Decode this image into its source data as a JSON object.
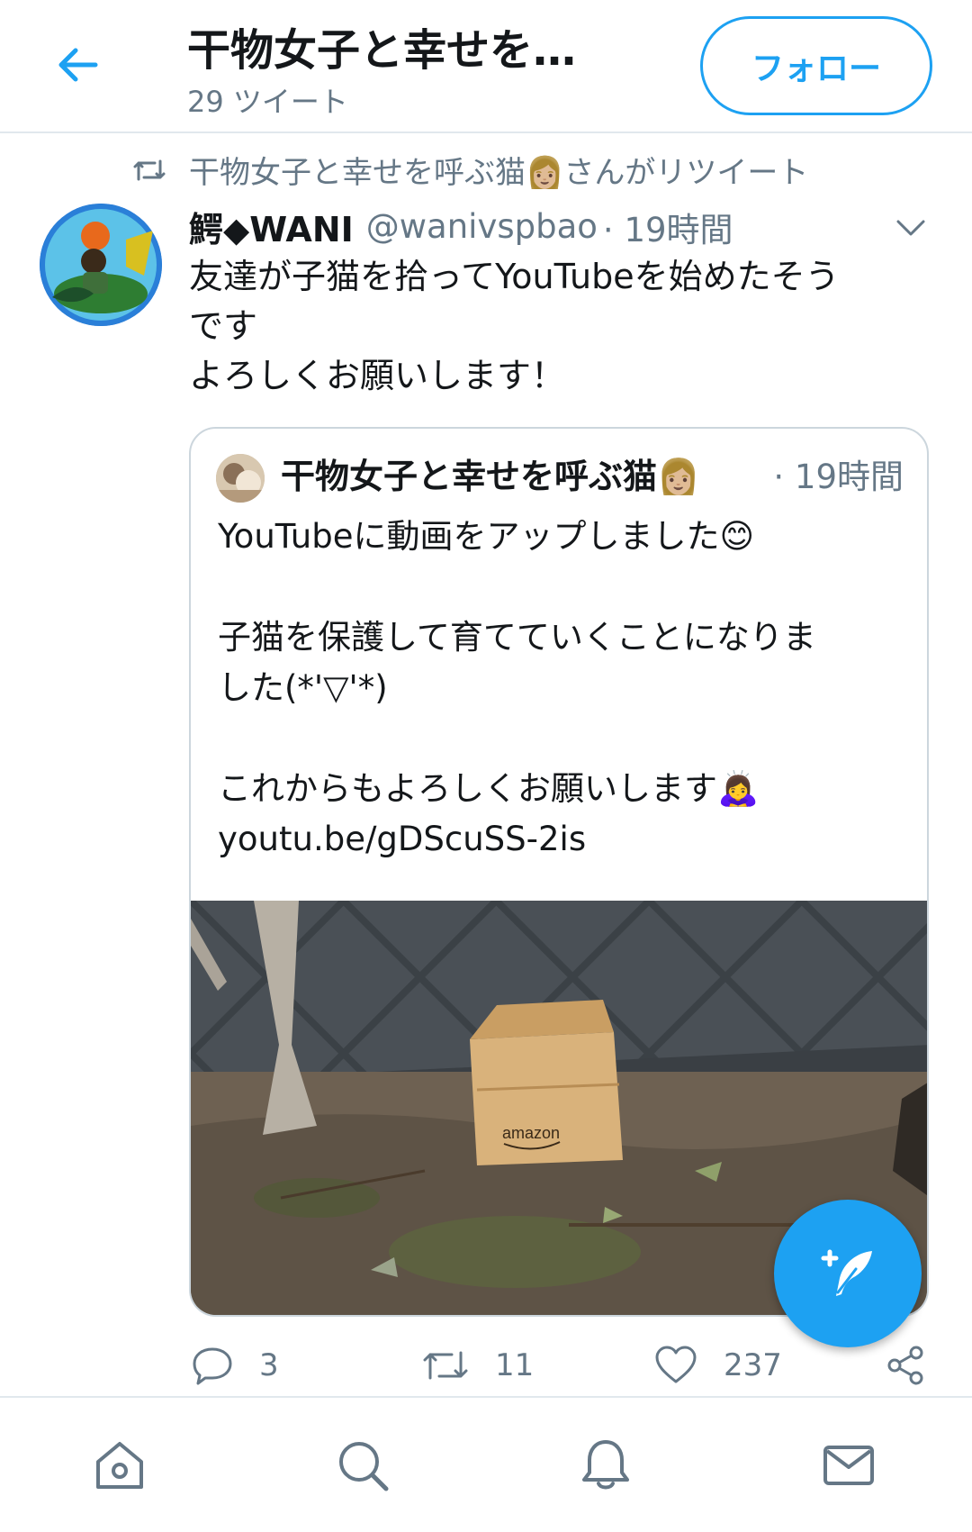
{
  "header": {
    "title": "干物女子と幸せを…",
    "tweet_count": "29 ツイート",
    "follow_label": "フォロー",
    "back_icon": "arrow-left-icon"
  },
  "retweet": {
    "text": "干物女子と幸せを呼ぶ猫👩🏼さんがリツイート",
    "icon": "retweet-icon"
  },
  "tweet": {
    "author_name": "鰐◆WANI",
    "handle": "@wanivspbao",
    "time": "· 19時間",
    "lines": [
      "友達が子猫を拾ってYouTubeを始めたそう",
      "です",
      "よろしくお願いします！"
    ],
    "stats": {
      "replies": "3",
      "retweets": "11",
      "likes": "237"
    }
  },
  "quote": {
    "author_name": "干物女子と幸せを呼ぶ猫👩🏼",
    "time": "· 19時間",
    "lines": [
      "YouTubeに動画をアップしました😊",
      "",
      "子猫を保護して育てていくことになりま",
      "した(*'▽'*)",
      "",
      "これからもよろしくお願いします🙇‍♀️",
      "youtu.be/gDScuSS-2is"
    ],
    "media_box_text": "amazon"
  },
  "colors": {
    "accent": "#1da1f2",
    "text_secondary": "#657786",
    "border": "#e1e8ed"
  },
  "nav": [
    "home-icon",
    "search-icon",
    "notifications-icon",
    "messages-icon"
  ]
}
